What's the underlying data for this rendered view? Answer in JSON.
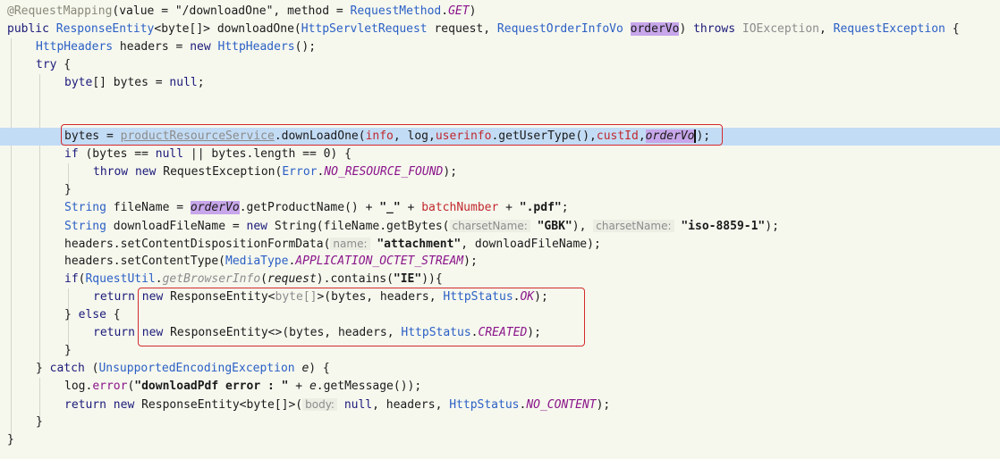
{
  "code": {
    "l1": {
      "ann": "@RequestMapping",
      "a": "(value = \"/downloadOne\", method = ",
      "b": "RequestMethod",
      "c": ".",
      "d": "GET",
      "e": ")"
    },
    "l2": {
      "kw1": "public ",
      "t1": "ResponseEntity",
      "a": "<byte[]> downloadOne(",
      "t2": "HttpServletRequest",
      "b": " request, ",
      "t3": "RequestOrderInfoVo",
      "c": " ",
      "hl": "orderVo",
      "d": ") ",
      "kw2": "throws",
      "e": " ",
      "g1": "IOException",
      "f": ", ",
      "t4": "RequestException",
      "g": " {"
    },
    "l3": {
      "t1": "HttpHeaders",
      "a": " headers = ",
      "kw": "new",
      "b": " ",
      "t2": "HttpHeaders",
      "c": "();"
    },
    "l4": {
      "kw": "try",
      "a": " {"
    },
    "l5": {
      "kw": "byte",
      "a": "[] bytes = ",
      "kw2": "null",
      "b": ";"
    },
    "l8": {
      "a": "bytes = ",
      "svc": "productResourceService",
      "b": ".downLoadOne(",
      "r1": "info",
      "c": ", log,",
      "r2": "userinfo",
      "d": ".getUserType(),",
      "r3": "custId",
      "e": ",",
      "hl": "orderVo",
      "f": ");"
    },
    "l9": {
      "kw": "if",
      "a": " (bytes == ",
      "kw2": "null",
      "b": " || bytes.length == 0) {"
    },
    "l10": {
      "kw": "throw",
      "a": " ",
      "kw2": "new",
      "b": " RequestException(",
      "t1": "Error",
      "c": ".",
      "cn": "NO_RESOURCE_FOUND",
      "d": ");"
    },
    "l11": {
      "a": "}"
    },
    "l12": {
      "t1": "String",
      "a": " fileName = ",
      "hl": "orderVo",
      "b": ".getProductName() + ",
      "s1": "\"_\"",
      "c": " + ",
      "r1": "batchNumber",
      "d": " + ",
      "s2": "\".pdf\"",
      "e": ";"
    },
    "l13": {
      "t1": "String",
      "a": " downloadFileName = ",
      "kw": "new",
      "b": " String(fileName.getBytes(",
      "h1": "charsetName:",
      "s1": "\"GBK\"",
      "c": "), ",
      "h2": "charsetName:",
      "s2": "\"iso-8859-1\"",
      "d": ");"
    },
    "l14": {
      "a": "headers.setContentDispositionFormData(",
      "h1": "name:",
      "s1": "\"attachment\"",
      "b": ", downloadFileName);"
    },
    "l15": {
      "a": "headers.setContentType(",
      "t1": "MediaType",
      "b": ".",
      "cn": "APPLICATION_OCTET_STREAM",
      "c": ");"
    },
    "l16": {
      "kw": "if",
      "a": "(",
      "t1": "RquestUtil",
      "b": ".",
      "fn": "getBrowserInfo",
      "c": "(",
      "it": "request",
      "d": ").contains(",
      "s1": "\"IE\"",
      "e": ")){"
    },
    "l17": {
      "kw": "return",
      "a": " ",
      "kw2": "new",
      "b": " ResponseEntity<",
      "g": "byte[]",
      "c": ">(bytes, headers, ",
      "t1": "HttpStatus",
      "d": ".",
      "cn": "OK",
      "e": ");"
    },
    "l18": {
      "a": "} ",
      "kw": "else",
      "b": " {"
    },
    "l19": {
      "kw": "return",
      "a": " ",
      "kw2": "new",
      "b": " ResponseEntity<>(bytes, headers, ",
      "t1": "HttpStatus",
      "c": ".",
      "cn": "CREATED",
      "d": ");"
    },
    "l20": {
      "a": "}"
    },
    "l21": {
      "a": "} ",
      "kw": "catch",
      "b": " (",
      "t1": "UnsupportedEncodingException",
      "c": " ",
      "it": "e",
      "d": ") {"
    },
    "l22": {
      "a": "log.",
      "fn": "error",
      "b": "(",
      "s1": "\"downloadPdf error : \"",
      "c": " + ",
      "it": "e",
      "d": ".getMessage());"
    },
    "l23": {
      "kw": "return",
      "a": " ",
      "kw2": "new",
      "b": " ResponseEntity<byte[]>(",
      "h1": "body:",
      "c": " ",
      "kw3": "null",
      "d": ", headers, ",
      "t1": "HttpStatus",
      "e": ".",
      "cn": "NO_CONTENT",
      "f": ");"
    },
    "l24": {
      "a": "}"
    },
    "l25": {
      "a": "}"
    }
  },
  "colors": {
    "background": "#f6f8ee",
    "current_line": "#c3dcf5",
    "highlight": "#c7a6ea",
    "box": "#d22a2a",
    "keyword": "#1c1a7a",
    "type": "#2b5fc5",
    "constant": "#8a148a",
    "red_field": "#c0282e"
  }
}
